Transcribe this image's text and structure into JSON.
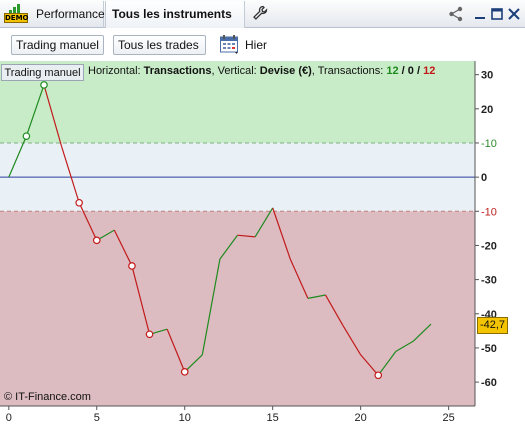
{
  "window": {
    "demo_label": "DEMO",
    "tab_performance": "Performance",
    "tab_instruments": "Tous les instruments"
  },
  "toolbar": {
    "dropdown1": "Trading manuel",
    "dropdown2": "Tous les trades",
    "date_label": "Hier"
  },
  "info": {
    "tab_label": "Trading manuel",
    "prefix": "Horizontal: ",
    "horizontal": "Transactions",
    "mid": ", Vertical: ",
    "vertical": "Devise (€)",
    "tx_label": ", Transactions: ",
    "tx_win": "12",
    "sep1": " / ",
    "tx_neutral": "0",
    "sep2": " / ",
    "tx_loss": "12"
  },
  "copyright": "© IT-Finance.com",
  "current_value_badge": "-42,7",
  "colors": {
    "gain_zone": "#c9ecc8",
    "neutral_zone": "#e9f0f6",
    "loss_zone": "#dcbcc1",
    "rising_line": "#1f8a1f",
    "falling_line": "#c21a1a",
    "zero_line": "#2b3c9c",
    "badge": "#f5c400"
  },
  "chart_data": {
    "type": "line",
    "x": [
      0,
      1,
      2,
      3,
      4,
      5,
      6,
      7,
      8,
      9,
      10,
      11,
      12,
      13,
      14,
      15,
      16,
      17,
      18,
      19,
      20,
      21,
      22,
      23,
      24
    ],
    "y": [
      0,
      12,
      27,
      9,
      -7.5,
      -18.5,
      -15.5,
      -26,
      -46,
      -44.5,
      -57,
      -52,
      -24,
      -17,
      -17.5,
      -9,
      -24,
      -35.5,
      -34.5,
      -43.5,
      -52,
      -58,
      -51,
      -48,
      -43
    ],
    "markers_at_x": [
      1,
      2,
      4,
      5,
      7,
      8,
      10,
      21
    ],
    "xlim": [
      -0.5,
      26.5
    ],
    "ylim": [
      -67,
      34
    ],
    "xticks": [
      0,
      5,
      10,
      15,
      20,
      25
    ],
    "yticks": [
      30,
      20,
      10,
      0,
      -10,
      -20,
      -30,
      -40,
      -50,
      -60
    ],
    "ytick_labels": [
      "30",
      "20",
      "-10",
      "0",
      "-10",
      "-20",
      "-30",
      "-40",
      "-50",
      "-60"
    ],
    "zones": {
      "upper": 10,
      "lower": -10
    },
    "zone_labels": {
      "upper": "10",
      "lower": "-10"
    },
    "last_value": -42.7
  }
}
